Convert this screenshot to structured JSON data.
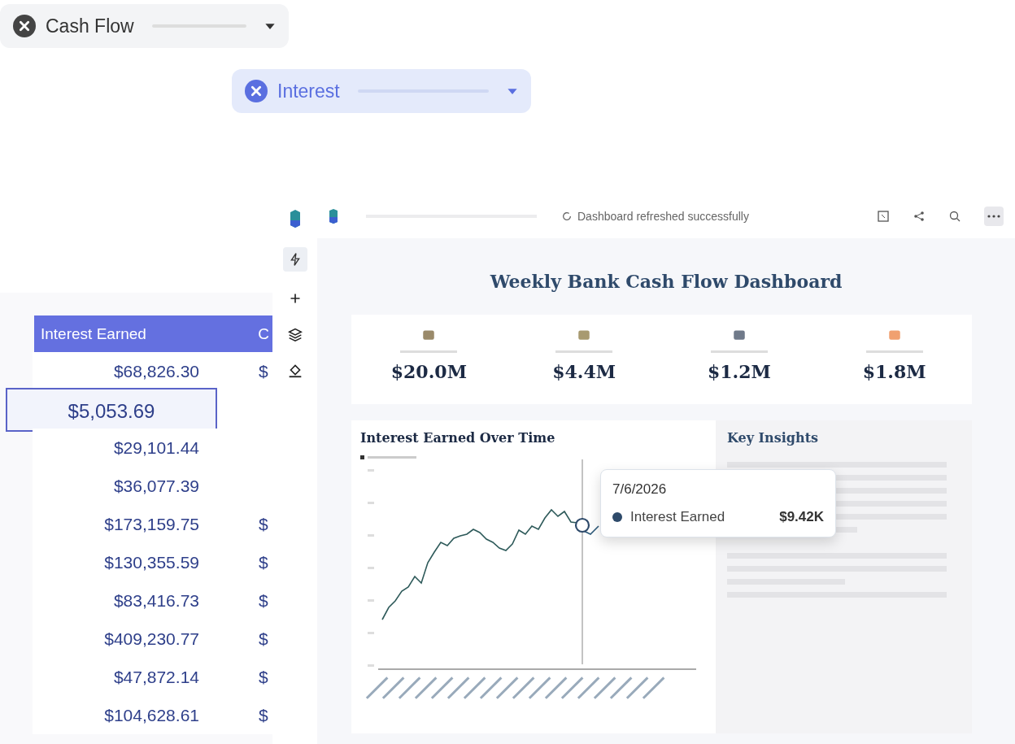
{
  "filters": [
    {
      "label": "Cash Flow",
      "selected": false
    },
    {
      "label": "Interest",
      "selected": true
    }
  ],
  "table": {
    "columns": [
      "Interest Earned",
      "C"
    ],
    "rows": [
      {
        "values": [
          "$68,826.30",
          "$"
        ],
        "selected": false
      },
      {
        "values": [
          "$5,053.69"
        ],
        "selected": true
      },
      {
        "values": [
          "$29,101.44"
        ],
        "selected": false
      },
      {
        "values": [
          "$36,077.39"
        ],
        "selected": false
      },
      {
        "values": [
          "$173,159.75",
          "$"
        ],
        "selected": false
      },
      {
        "values": [
          "$130,355.59",
          "$"
        ],
        "selected": false
      },
      {
        "values": [
          "$83,416.73",
          "$"
        ],
        "selected": false
      },
      {
        "values": [
          "$409,230.77",
          "$"
        ],
        "selected": false
      },
      {
        "values": [
          "$47,872.14",
          "$"
        ],
        "selected": false
      },
      {
        "values": [
          "$104,628.61",
          "$"
        ],
        "selected": false
      }
    ]
  },
  "dashboard": {
    "toast": "Dashboard refreshed successfully",
    "title": "Weekly Bank Cash Flow Dashboard",
    "kpis": [
      {
        "value": "$20.0M"
      },
      {
        "value": "$4.4M"
      },
      {
        "value": "$1.2M"
      },
      {
        "value": "$1.8M"
      }
    ],
    "chart": {
      "title": "Interest Earned Over Time",
      "tooltip": {
        "date": "7/6/2026",
        "series": "Interest Earned",
        "value": "$9.42K"
      }
    },
    "insights": {
      "title": "Key Insights"
    }
  }
}
